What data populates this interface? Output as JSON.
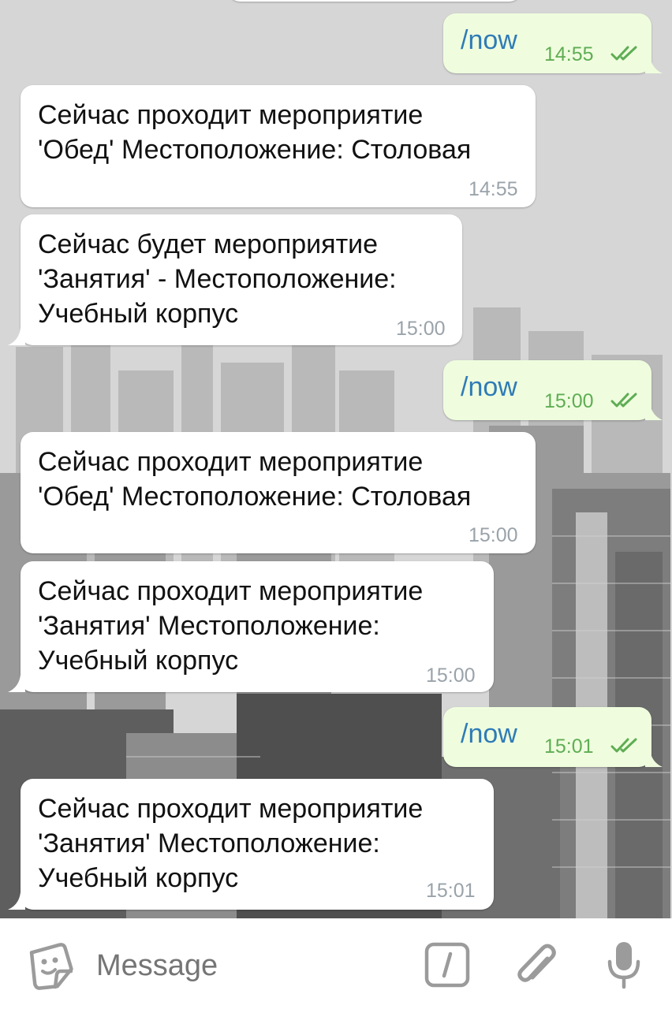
{
  "messages": [
    {
      "direction": "out",
      "text": "/now",
      "time": "14:55",
      "status": "read"
    },
    {
      "direction": "in",
      "text": "Сейчас проходит мероприятие\n'Обед' Местоположение: Столовая",
      "time": "14:55"
    },
    {
      "direction": "in",
      "text": "Сейчас будет мероприятие\n'Занятия' - Местоположение:\nУчебный корпус",
      "time": "15:00"
    },
    {
      "direction": "out",
      "text": "/now",
      "time": "15:00",
      "status": "read"
    },
    {
      "direction": "in",
      "text": "Сейчас проходит мероприятие\n'Обед' Местоположение: Столовая",
      "time": "15:00"
    },
    {
      "direction": "in",
      "text": "Сейчас проходит мероприятие\n'Занятия' Местоположение:\nУчебный корпус",
      "time": "15:00"
    },
    {
      "direction": "out",
      "text": "/now",
      "time": "15:01",
      "status": "read"
    },
    {
      "direction": "in",
      "text": "Сейчас проходит мероприятие\n'Занятия' Местоположение:\nУчебный корпус",
      "time": "15:01"
    }
  ],
  "input": {
    "placeholder": "Message",
    "icons": [
      "sticker-icon",
      "bot-command-icon",
      "attach-icon",
      "microphone-icon"
    ]
  },
  "colors": {
    "outgoing_bubble": "#effdde",
    "incoming_bubble": "#ffffff",
    "outgoing_text": "#2f7bb7",
    "outgoing_time": "#5fad54",
    "incoming_time": "#9aa3aa",
    "input_icon": "#9b9b9b"
  }
}
